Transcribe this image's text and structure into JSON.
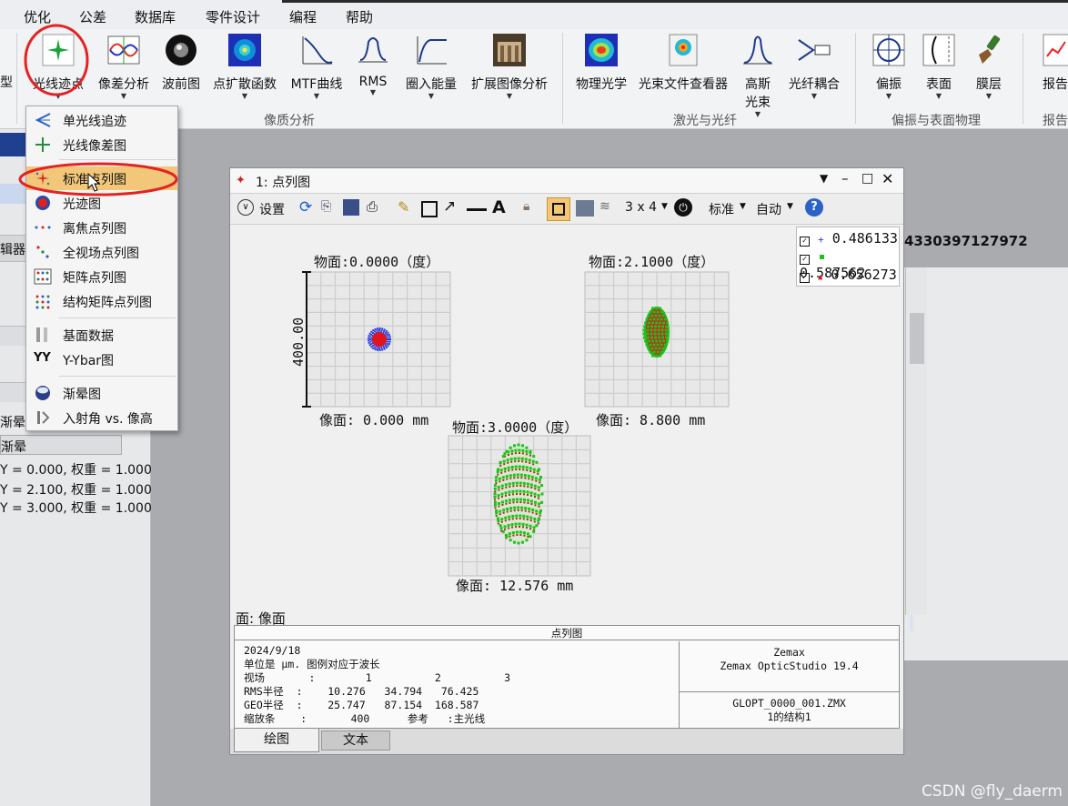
{
  "menu": [
    "优化",
    "公差",
    "数据库",
    "零件设计",
    "编程",
    "帮助"
  ],
  "ribbon": {
    "left_clip": "型",
    "buttons": [
      {
        "label": "光线迹点",
        "icon": "ray-trace-star-icon"
      },
      {
        "label": "像差分析",
        "icon": "aberration-icon"
      },
      {
        "label": "波前图",
        "icon": "wavefront-icon"
      },
      {
        "label": "点扩散函数",
        "icon": "psf-icon"
      },
      {
        "label": "MTF曲线",
        "icon": "mtf-icon"
      },
      {
        "label": "RMS",
        "icon": "rms-icon"
      },
      {
        "label": "圈入能量",
        "icon": "encircled-energy-icon"
      },
      {
        "label": "扩展图像分析",
        "icon": "extended-image-icon"
      },
      {
        "label": "物理光学",
        "icon": "physical-optics-icon"
      },
      {
        "label": "光束文件查看器",
        "icon": "beam-file-viewer-icon"
      },
      {
        "label": "高斯",
        "label2": "光束",
        "icon": "gaussian-beam-icon"
      },
      {
        "label": "光纤耦合",
        "icon": "fiber-coupling-icon"
      },
      {
        "label": "偏振",
        "icon": "polarization-icon"
      },
      {
        "label": "表面",
        "icon": "surface-icon"
      },
      {
        "label": "膜层",
        "icon": "coating-icon"
      },
      {
        "label": "报告",
        "icon": "report-icon"
      }
    ],
    "groups": [
      "像质分析",
      "激光与光纤",
      "偏振与表面物理",
      "报告"
    ]
  },
  "dropdown": {
    "items": [
      {
        "label": "单光线追迹"
      },
      {
        "label": "光线像差图"
      },
      {
        "label": "标准点列图",
        "highlight": true
      },
      {
        "label": "光迹图"
      },
      {
        "label": "离焦点列图"
      },
      {
        "label": "全视场点列图"
      },
      {
        "label": "矩阵点列图"
      },
      {
        "label": "结构矩阵点列图"
      },
      {
        "label": "基面数据"
      },
      {
        "label": "Y-Ybar图"
      },
      {
        "label": "渐晕图"
      },
      {
        "label": "入射角 vs. 像高"
      }
    ]
  },
  "left_panel": {
    "editor_clip": "辑器",
    "vignette": "渐晕",
    "vignette_box": "渐晕",
    "fields": [
      "Y = 0.000, 权重 = 1.000)",
      "Y = 2.100, 权重 = 1.000)",
      "Y = 3.000, 权重 = 1.000)"
    ]
  },
  "right_panel": {
    "number_clip": "4330397127972"
  },
  "window": {
    "title": "1: 点列图",
    "toolbar": {
      "settings": "设置",
      "layout": "3 x 4",
      "standard": "标准",
      "auto": "自动"
    },
    "legend": [
      "0.486133",
      "0.587562",
      "0.656273"
    ],
    "legend_colors": [
      "#2a3dd8",
      "#19c419",
      "#e0141e"
    ],
    "plots": [
      {
        "object": "物面:0.0000（度）",
        "image": "像面:  0.000  mm"
      },
      {
        "object": "物面:2.1000（度）",
        "image": "像面:  8.800  mm"
      },
      {
        "object": "物面:3.0000（度）",
        "image": "像面:  12.576  mm"
      }
    ],
    "scale_label": "400.00",
    "surface_label": "面: 像面",
    "info": {
      "header": "点列图",
      "date": "2024/9/18",
      "units_line": "单位是 μm. 图例对应于波长",
      "field_line": "视场       :        1          2          3",
      "rms_line": "RMS半径  :    10.276   34.794   76.425",
      "geo_line": "GEO半径  :    25.747   87.154  168.587",
      "scale_line": "缩放条    :       400      参考   :主光线",
      "company": "Zemax",
      "product": "Zemax OpticStudio 19.4",
      "file": "GLOPT_0000_001.ZMX",
      "config": "1的结构1"
    },
    "tabs": [
      "绘图",
      "文本"
    ]
  },
  "watermark": "CSDN @fly_daerm"
}
